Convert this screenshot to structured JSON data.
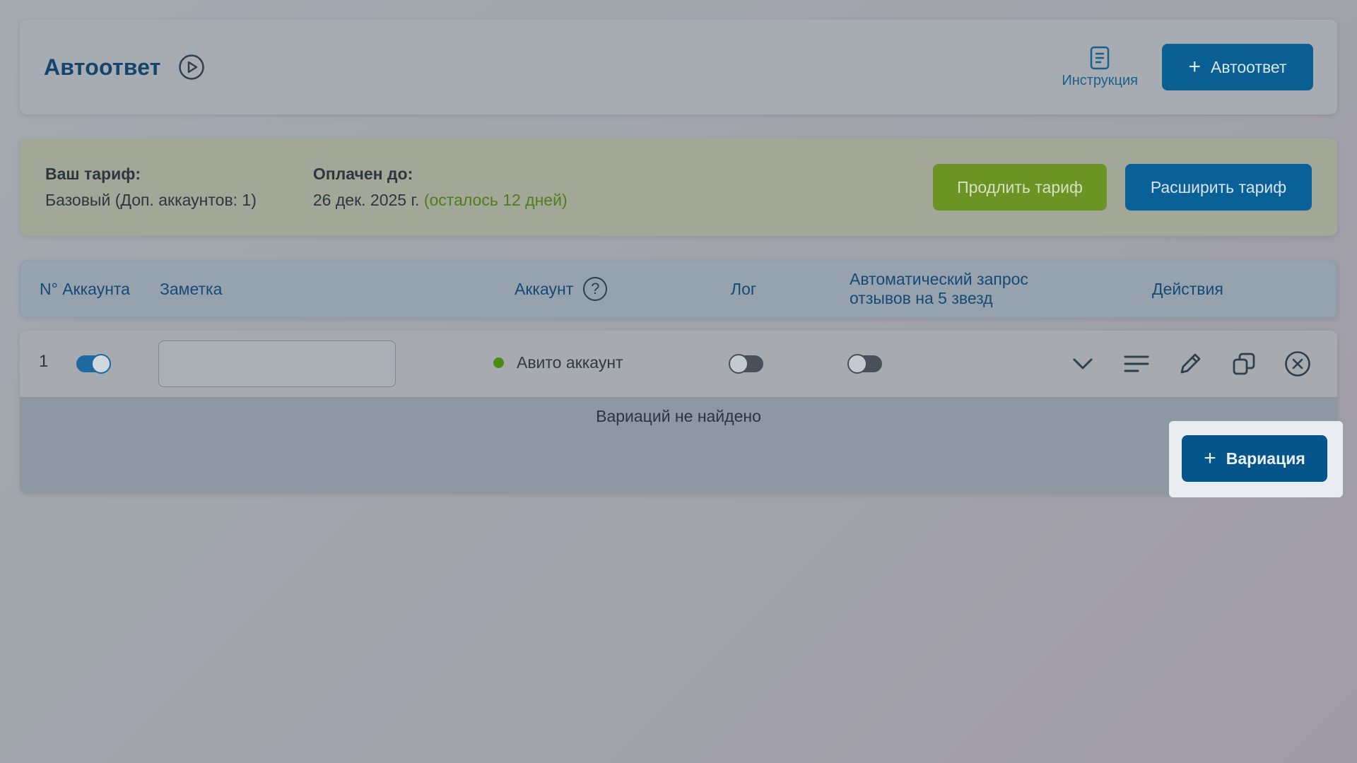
{
  "header": {
    "title": "Автоответ",
    "instruction_label": "Инструкция",
    "add_button_label": "Автоответ"
  },
  "tariff": {
    "tariff_label": "Ваш тариф:",
    "tariff_value": "Базовый (Доп. аккаунтов: 1)",
    "paid_label": "Оплачен до:",
    "paid_date": "26 дек. 2025 г.",
    "remaining": "(осталось 12 дней)",
    "extend_label": "Продлить тариф",
    "expand_label": "Расширить тариф"
  },
  "table": {
    "col_account_no": "N° Аккаунта",
    "col_note": "Заметка",
    "col_account": "Аккаунт",
    "col_log": "Лог",
    "col_auto_line1": "Автоматический запрос",
    "col_auto_line2": "отзывов на 5 звезд",
    "col_actions": "Действия"
  },
  "row": {
    "number": "1",
    "enabled": true,
    "note_value": "",
    "account_name": "Авито аккаунт",
    "log_enabled": false,
    "auto_review_enabled": false
  },
  "variations": {
    "empty_text": "Вариаций не найдено",
    "add_label": "Вариация"
  },
  "icons": {
    "play": "play-circle-icon",
    "instruction": "document-icon",
    "help": "question-icon",
    "expand": "chevron-down-icon",
    "log": "list-lines-icon",
    "edit": "pencil-icon",
    "copy": "copy-icon",
    "delete": "close-circle-icon"
  },
  "colors": {
    "primary": "#0a5f93",
    "success": "#6b9424",
    "title": "#15456c"
  }
}
